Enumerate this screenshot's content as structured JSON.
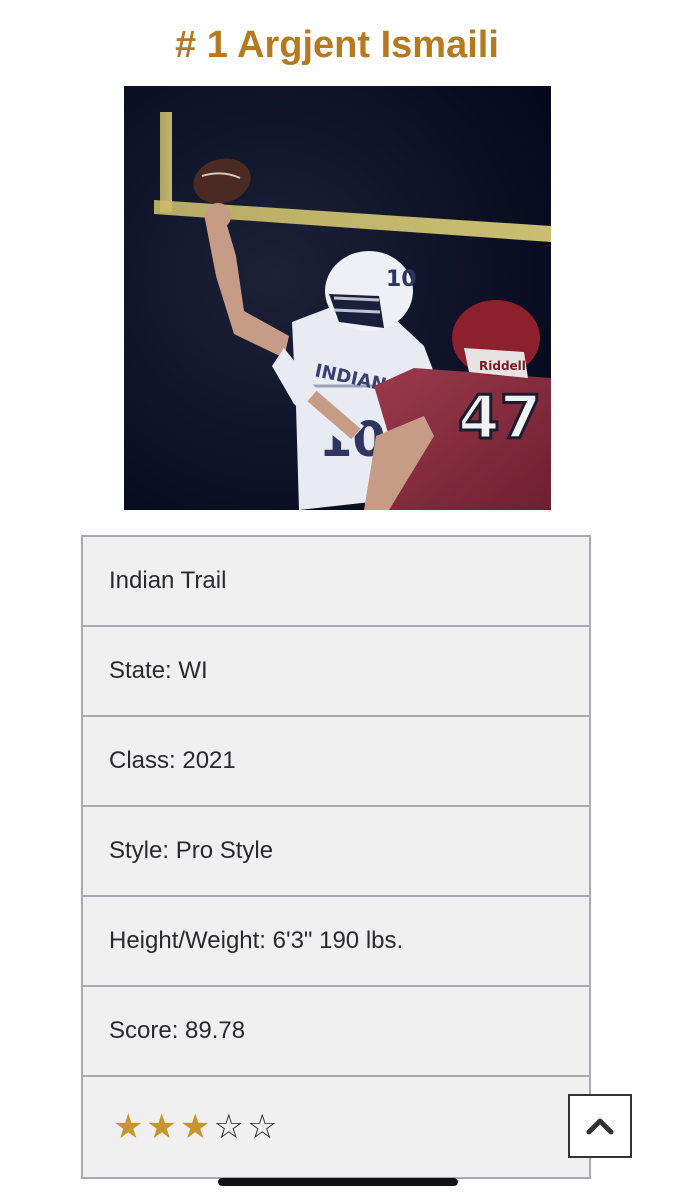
{
  "header": {
    "title": "# 1 Argjent Ismaili"
  },
  "photo": {
    "jersey_text": "INDIAN TRAIL",
    "jersey_number": "10",
    "helmet_number": "10",
    "opponent_number": "47",
    "helmet_brand": "Riddell"
  },
  "info": {
    "school": "Indian Trail",
    "state": "State: WI",
    "class": "Class: 2021",
    "style": "Style: Pro Style",
    "height_weight": "Height/Weight: 6'3\"  190 lbs.",
    "score": "Score: 89.78"
  },
  "rating": {
    "stars_filled": 3,
    "stars_total": 5,
    "filled_glyph": "★",
    "empty_glyph": "☆"
  },
  "colors": {
    "title": "#b57a1f",
    "star": "#c8942c"
  },
  "icons": {
    "scroll_top": "chevron-up-icon"
  }
}
